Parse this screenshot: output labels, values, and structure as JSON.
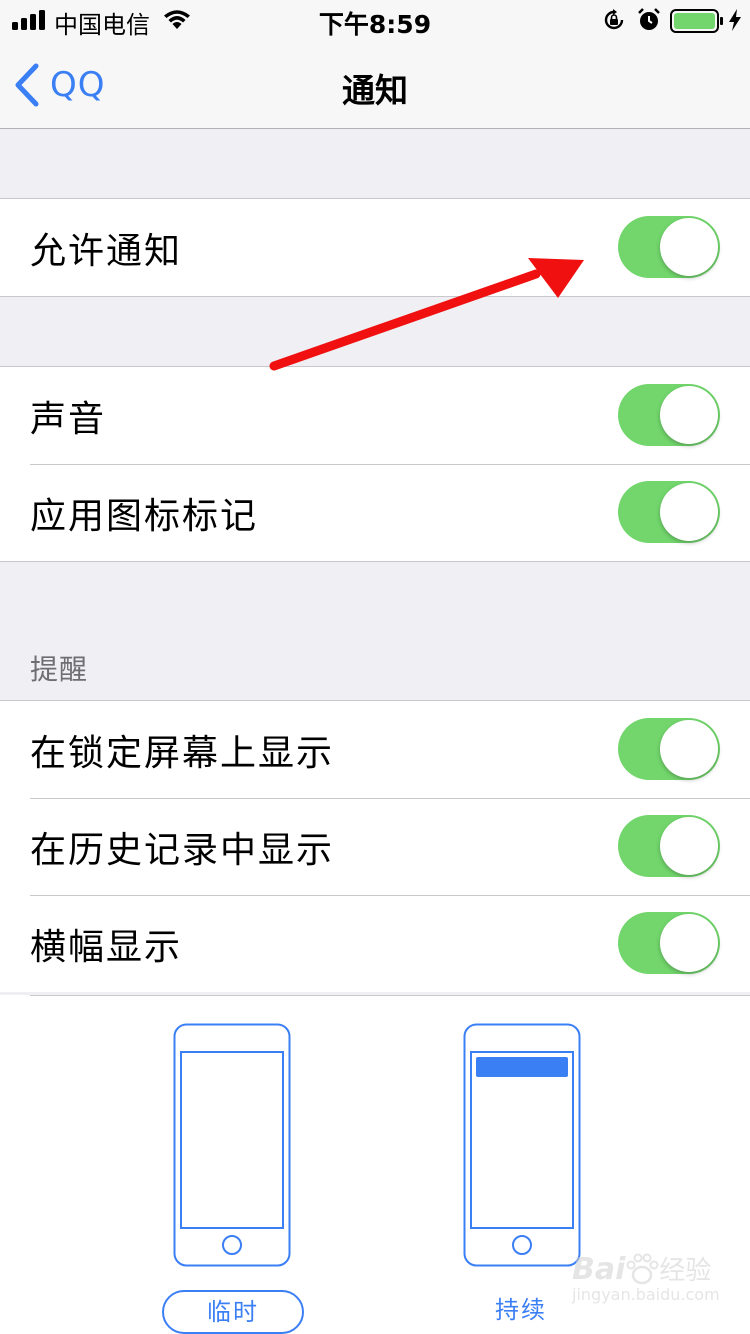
{
  "status_bar": {
    "carrier": "中国电信",
    "time": "下午8:59"
  },
  "nav": {
    "back_label": "QQ",
    "title": "通知"
  },
  "sections": {
    "allow": {
      "label": "允许通知",
      "on": true
    },
    "sound": {
      "label": "声音",
      "on": true
    },
    "badge": {
      "label": "应用图标标记",
      "on": true
    },
    "alerts_header": "提醒",
    "lock_screen": {
      "label": "在锁定屏幕上显示",
      "on": true
    },
    "history": {
      "label": "在历史记录中显示",
      "on": true
    },
    "banner": {
      "label": "横幅显示",
      "on": true
    }
  },
  "banner_styles": {
    "temporary": "临时",
    "persistent": "持续",
    "selected": "临时"
  },
  "watermark": {
    "brand": "Bai",
    "brand_tail": "经验",
    "url": "jingyan.baidu.com"
  },
  "colors": {
    "accent": "#3b7ff5",
    "toggle_on": "#72d66c",
    "arrow": "#f01010"
  }
}
